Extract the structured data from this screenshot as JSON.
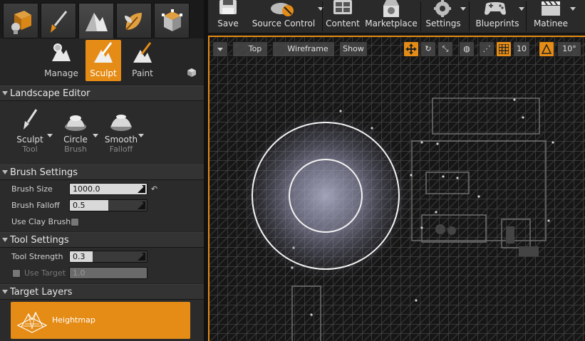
{
  "modes": {
    "tabs": [
      {
        "name": "place-mode-tab",
        "icon": "cube-icon"
      },
      {
        "name": "paint-mode-tab",
        "icon": "brush-icon"
      },
      {
        "name": "landscape-mode-tab",
        "icon": "mountain-icon",
        "active": true
      },
      {
        "name": "foliage-mode-tab",
        "icon": "leaf-icon"
      },
      {
        "name": "geometry-mode-tab",
        "icon": "geometry-icon"
      }
    ]
  },
  "tools": {
    "items": [
      {
        "label": "Manage",
        "icon": "manage-icon"
      },
      {
        "label": "Sculpt",
        "icon": "sculpt-icon",
        "active": true
      },
      {
        "label": "Paint",
        "icon": "paint-icon"
      }
    ]
  },
  "landscape_editor": {
    "title": "Landscape Editor",
    "tool": {
      "label": "Sculpt",
      "sub": "Tool"
    },
    "brush": {
      "label": "Circle",
      "sub": "Brush"
    },
    "falloff": {
      "label": "Smooth",
      "sub": "Falloff"
    }
  },
  "brush_settings": {
    "title": "Brush Settings",
    "brush_size": {
      "label": "Brush Size",
      "value": "1000.0",
      "fill": 1.0
    },
    "brush_falloff": {
      "label": "Brush Falloff",
      "value": "0.5",
      "fill": 0.5
    },
    "use_clay_brush": {
      "label": "Use Clay Brush",
      "checked": false
    }
  },
  "tool_settings": {
    "title": "Tool Settings",
    "tool_strength": {
      "label": "Tool Strength",
      "value": "0.3",
      "fill": 0.3
    },
    "use_target": {
      "label": "Use Target",
      "value": "1.0",
      "enabled": false
    }
  },
  "target_layers": {
    "title": "Target Layers",
    "layers": [
      {
        "name": "Heightmap",
        "selected": true
      }
    ]
  },
  "toolbar": {
    "save": "Save",
    "source_control": "Source Control",
    "content": "Content",
    "marketplace": "Marketplace",
    "settings": "Settings",
    "blueprints": "Blueprints",
    "matinee": "Matinee"
  },
  "viewport": {
    "view": "Top",
    "view_mode": "Wireframe",
    "show": "Show",
    "grid_snap": "10",
    "rotation_snap": "10°"
  },
  "colors": {
    "accent": "#e58c16",
    "panel": "#242424",
    "viewport_bg": "#161616"
  }
}
